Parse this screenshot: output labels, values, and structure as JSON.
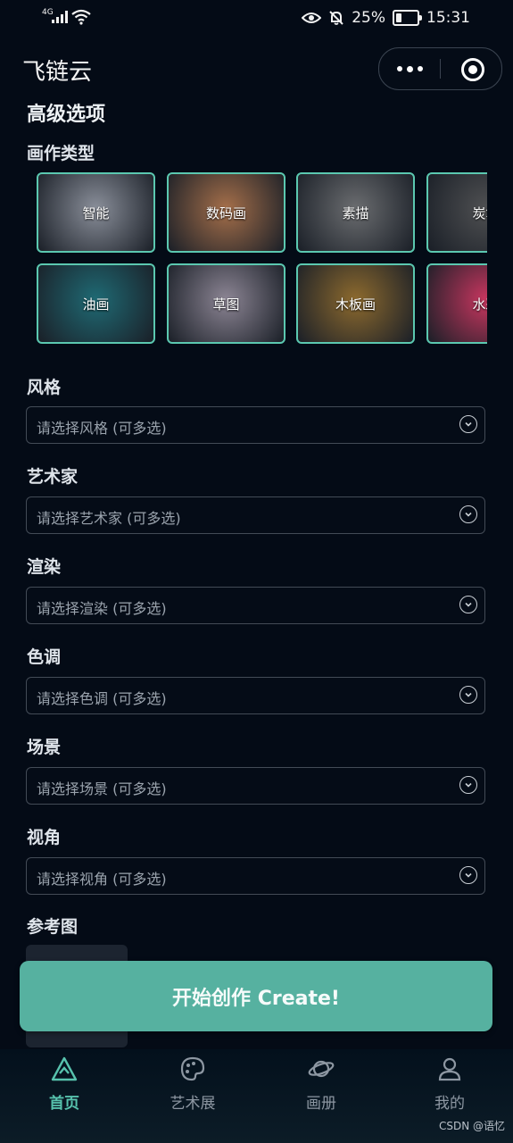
{
  "status_bar": {
    "network": "4G",
    "battery_percent": "25%",
    "battery_level": 0.25,
    "time": "15:31"
  },
  "header": {
    "app_title": "飞链云"
  },
  "advanced": {
    "title": "高级选项",
    "painting_type_label": "画作类型",
    "types": [
      {
        "label": "智能",
        "bg": "#8a8f9a"
      },
      {
        "label": "数码画",
        "bg": "#a56f4a"
      },
      {
        "label": "素描",
        "bg": "#6b6d70"
      },
      {
        "label": "炭笔",
        "bg": "#4f5052"
      },
      {
        "label": "油画",
        "bg": "#1f6a74"
      },
      {
        "label": "草图",
        "bg": "#8c8594"
      },
      {
        "label": "木板画",
        "bg": "#8d6a2e"
      },
      {
        "label": "水彩",
        "bg": "#c7365f"
      }
    ]
  },
  "selects": [
    {
      "label": "风格",
      "placeholder": "请选择风格 (可多选)"
    },
    {
      "label": "艺术家",
      "placeholder": "请选择艺术家 (可多选)"
    },
    {
      "label": "渲染",
      "placeholder": "请选择渲染 (可多选)"
    },
    {
      "label": "色调",
      "placeholder": "请选择色调 (可多选)"
    },
    {
      "label": "场景",
      "placeholder": "请选择场景 (可多选)"
    },
    {
      "label": "视角",
      "placeholder": "请选择视角 (可多选)"
    }
  ],
  "reference": {
    "label": "参考图"
  },
  "create_button": "开始创作 Create!",
  "tabs": [
    {
      "label": "首页",
      "icon": "home-icon",
      "active": true
    },
    {
      "label": "艺术展",
      "icon": "palette-icon",
      "active": false
    },
    {
      "label": "画册",
      "icon": "planet-icon",
      "active": false
    },
    {
      "label": "我的",
      "icon": "user-icon",
      "active": false
    }
  ],
  "watermark": "CSDN @语忆",
  "colors": {
    "accent": "#57c2ad",
    "background": "#040b16",
    "button": "#56b1a0"
  }
}
